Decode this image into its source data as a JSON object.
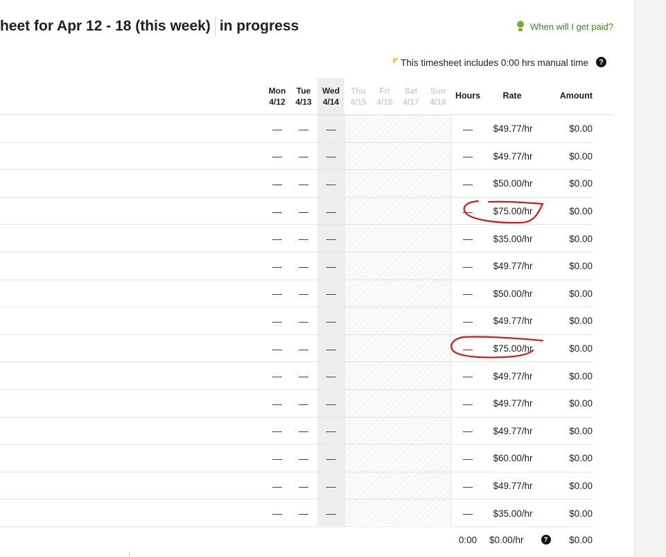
{
  "header": {
    "title": "heet for Apr 12 - 18 (this week)",
    "status": "in progress",
    "paid_link": "When will I get paid?",
    "bulb_icon": "lightbulb-icon"
  },
  "manual_note": {
    "text": "This timesheet includes 0:00 hrs manual time",
    "flag_icon": "corner-flag-icon",
    "flag_color": "#f2c744",
    "help_icon": "question-circle-icon"
  },
  "columns": {
    "days": [
      {
        "name": "Mon",
        "date": "4/12",
        "future": false
      },
      {
        "name": "Tue",
        "date": "4/13",
        "future": false
      },
      {
        "name": "Wed",
        "date": "4/14",
        "future": false
      },
      {
        "name": "Thu",
        "date": "4/15",
        "future": true
      },
      {
        "name": "Fri",
        "date": "4/16",
        "future": true
      },
      {
        "name": "Sat",
        "date": "4/17",
        "future": true
      },
      {
        "name": "Sun",
        "date": "4/18",
        "future": true
      }
    ],
    "hours": "Hours",
    "rate": "Rate",
    "amount": "Amount"
  },
  "rows": [
    {
      "mon": "—",
      "tue": "—",
      "wed": "—",
      "hours": "—",
      "rate": "$49.77/hr",
      "amount": "$0.00"
    },
    {
      "mon": "—",
      "tue": "—",
      "wed": "—",
      "hours": "—",
      "rate": "$49.77/hr",
      "amount": "$0.00"
    },
    {
      "mon": "—",
      "tue": "—",
      "wed": "—",
      "hours": "—",
      "rate": "$50.00/hr",
      "amount": "$0.00"
    },
    {
      "mon": "—",
      "tue": "—",
      "wed": "—",
      "hours": "—",
      "rate": "$75.00/hr",
      "amount": "$0.00"
    },
    {
      "mon": "—",
      "tue": "—",
      "wed": "—",
      "hours": "—",
      "rate": "$35.00/hr",
      "amount": "$0.00"
    },
    {
      "mon": "—",
      "tue": "—",
      "wed": "—",
      "hours": "—",
      "rate": "$49.77/hr",
      "amount": "$0.00"
    },
    {
      "mon": "—",
      "tue": "—",
      "wed": "—",
      "hours": "—",
      "rate": "$50.00/hr",
      "amount": "$0.00"
    },
    {
      "mon": "—",
      "tue": "—",
      "wed": "—",
      "hours": "—",
      "rate": "$49.77/hr",
      "amount": "$0.00"
    },
    {
      "mon": "—",
      "tue": "—",
      "wed": "—",
      "hours": "—",
      "rate": "$75.00/hr",
      "amount": "$0.00"
    },
    {
      "mon": "—",
      "tue": "—",
      "wed": "—",
      "hours": "—",
      "rate": "$49.77/hr",
      "amount": "$0.00"
    },
    {
      "mon": "—",
      "tue": "—",
      "wed": "—",
      "hours": "—",
      "rate": "$49.77/hr",
      "amount": "$0.00"
    },
    {
      "mon": "—",
      "tue": "—",
      "wed": "—",
      "hours": "—",
      "rate": "$49.77/hr",
      "amount": "$0.00"
    },
    {
      "mon": "—",
      "tue": "—",
      "wed": "—",
      "hours": "—",
      "rate": "$60.00/hr",
      "amount": "$0.00"
    },
    {
      "mon": "—",
      "tue": "—",
      "wed": "—",
      "hours": "—",
      "rate": "$49.77/hr",
      "amount": "$0.00"
    },
    {
      "mon": "—",
      "tue": "—",
      "wed": "—",
      "hours": "—",
      "rate": "$35.00/hr",
      "amount": "$0.00"
    }
  ],
  "totals": {
    "hours": "0:00",
    "rate": "$0.00/hr",
    "amount": "$0.00",
    "help_icon": "question-circle-icon"
  },
  "colors": {
    "link_green": "#3a8b1d",
    "today_band": "#eeeeee",
    "annotation_red": "#d11a1a"
  }
}
